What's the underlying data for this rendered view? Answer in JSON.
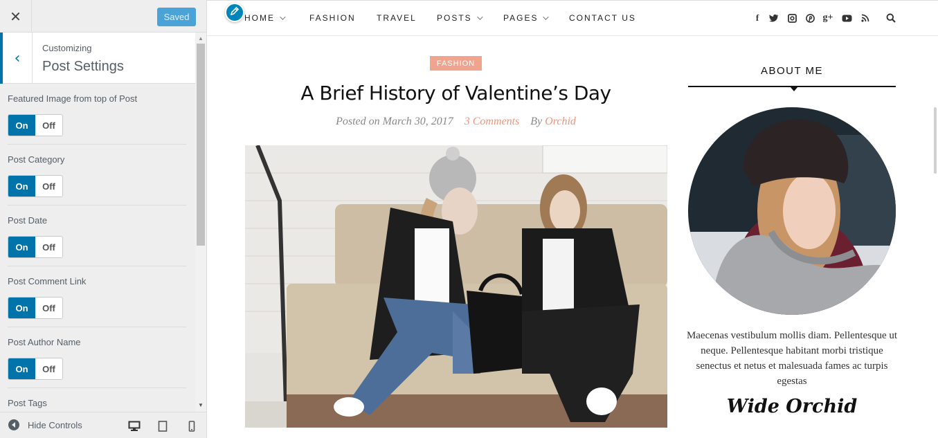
{
  "customizer": {
    "close_icon": "close-icon",
    "saved_label": "Saved",
    "customizing_label": "Customizing",
    "section_title": "Post Settings",
    "controls": [
      {
        "label": "Featured Image from top of Post",
        "on": "On",
        "off": "Off",
        "value": "on"
      },
      {
        "label": "Post Category",
        "on": "On",
        "off": "Off",
        "value": "on"
      },
      {
        "label": "Post Date",
        "on": "On",
        "off": "Off",
        "value": "on"
      },
      {
        "label": "Post Comment Link",
        "on": "On",
        "off": "Off",
        "value": "on"
      },
      {
        "label": "Post Author Name",
        "on": "On",
        "off": "Off",
        "value": "on"
      },
      {
        "label": "Post Tags"
      }
    ],
    "footer": {
      "hide_controls_label": "Hide Controls",
      "devices": [
        "desktop-icon",
        "tablet-icon",
        "mobile-icon"
      ]
    },
    "accent_color": "#0073aa"
  },
  "site": {
    "nav": {
      "items": [
        {
          "label": "HOME",
          "has_dropdown": true
        },
        {
          "label": "FASHION",
          "has_dropdown": false
        },
        {
          "label": "TRAVEL",
          "has_dropdown": false
        },
        {
          "label": "POSTS",
          "has_dropdown": true
        },
        {
          "label": "PAGES",
          "has_dropdown": true
        },
        {
          "label": "CONTACT US",
          "has_dropdown": false
        }
      ],
      "social_icons": [
        "facebook-icon",
        "twitter-icon",
        "instagram-icon",
        "pinterest-icon",
        "google-plus-icon",
        "youtube-icon",
        "rss-icon",
        "search-icon"
      ]
    },
    "post": {
      "category": "FASHION",
      "title": "A Brief History of Valentine’s Day",
      "meta": {
        "posted_on": "Posted on March 30, 2017",
        "comments": "3 Comments",
        "by": "By",
        "author": "Orchid"
      }
    },
    "sidebar": {
      "about_title": "ABOUT ME",
      "about_text": "Maecenas vestibulum mollis diam. Pellentesque ut neque. Pellentesque habitant morbi tristique senectus et netus et malesuada fames ac turpis egestas",
      "signature": "Wide Orchid"
    },
    "accent_color": "#f0937a"
  }
}
